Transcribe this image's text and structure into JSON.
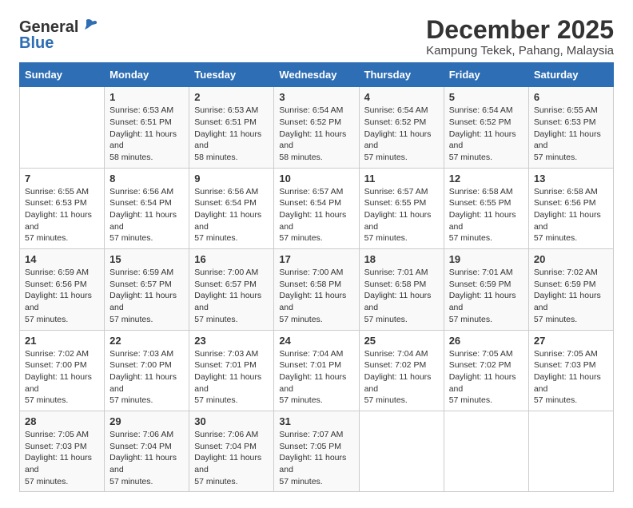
{
  "logo": {
    "general": "General",
    "blue": "Blue"
  },
  "title": "December 2025",
  "subtitle": "Kampung Tekek, Pahang, Malaysia",
  "header": {
    "days": [
      "Sunday",
      "Monday",
      "Tuesday",
      "Wednesday",
      "Thursday",
      "Friday",
      "Saturday"
    ]
  },
  "weeks": [
    [
      {
        "num": "",
        "sunrise": "",
        "sunset": "",
        "daylight": ""
      },
      {
        "num": "1",
        "sunrise": "Sunrise: 6:53 AM",
        "sunset": "Sunset: 6:51 PM",
        "daylight": "Daylight: 11 hours and 58 minutes."
      },
      {
        "num": "2",
        "sunrise": "Sunrise: 6:53 AM",
        "sunset": "Sunset: 6:51 PM",
        "daylight": "Daylight: 11 hours and 58 minutes."
      },
      {
        "num": "3",
        "sunrise": "Sunrise: 6:54 AM",
        "sunset": "Sunset: 6:52 PM",
        "daylight": "Daylight: 11 hours and 58 minutes."
      },
      {
        "num": "4",
        "sunrise": "Sunrise: 6:54 AM",
        "sunset": "Sunset: 6:52 PM",
        "daylight": "Daylight: 11 hours and 57 minutes."
      },
      {
        "num": "5",
        "sunrise": "Sunrise: 6:54 AM",
        "sunset": "Sunset: 6:52 PM",
        "daylight": "Daylight: 11 hours and 57 minutes."
      },
      {
        "num": "6",
        "sunrise": "Sunrise: 6:55 AM",
        "sunset": "Sunset: 6:53 PM",
        "daylight": "Daylight: 11 hours and 57 minutes."
      }
    ],
    [
      {
        "num": "7",
        "sunrise": "Sunrise: 6:55 AM",
        "sunset": "Sunset: 6:53 PM",
        "daylight": "Daylight: 11 hours and 57 minutes."
      },
      {
        "num": "8",
        "sunrise": "Sunrise: 6:56 AM",
        "sunset": "Sunset: 6:54 PM",
        "daylight": "Daylight: 11 hours and 57 minutes."
      },
      {
        "num": "9",
        "sunrise": "Sunrise: 6:56 AM",
        "sunset": "Sunset: 6:54 PM",
        "daylight": "Daylight: 11 hours and 57 minutes."
      },
      {
        "num": "10",
        "sunrise": "Sunrise: 6:57 AM",
        "sunset": "Sunset: 6:54 PM",
        "daylight": "Daylight: 11 hours and 57 minutes."
      },
      {
        "num": "11",
        "sunrise": "Sunrise: 6:57 AM",
        "sunset": "Sunset: 6:55 PM",
        "daylight": "Daylight: 11 hours and 57 minutes."
      },
      {
        "num": "12",
        "sunrise": "Sunrise: 6:58 AM",
        "sunset": "Sunset: 6:55 PM",
        "daylight": "Daylight: 11 hours and 57 minutes."
      },
      {
        "num": "13",
        "sunrise": "Sunrise: 6:58 AM",
        "sunset": "Sunset: 6:56 PM",
        "daylight": "Daylight: 11 hours and 57 minutes."
      }
    ],
    [
      {
        "num": "14",
        "sunrise": "Sunrise: 6:59 AM",
        "sunset": "Sunset: 6:56 PM",
        "daylight": "Daylight: 11 hours and 57 minutes."
      },
      {
        "num": "15",
        "sunrise": "Sunrise: 6:59 AM",
        "sunset": "Sunset: 6:57 PM",
        "daylight": "Daylight: 11 hours and 57 minutes."
      },
      {
        "num": "16",
        "sunrise": "Sunrise: 7:00 AM",
        "sunset": "Sunset: 6:57 PM",
        "daylight": "Daylight: 11 hours and 57 minutes."
      },
      {
        "num": "17",
        "sunrise": "Sunrise: 7:00 AM",
        "sunset": "Sunset: 6:58 PM",
        "daylight": "Daylight: 11 hours and 57 minutes."
      },
      {
        "num": "18",
        "sunrise": "Sunrise: 7:01 AM",
        "sunset": "Sunset: 6:58 PM",
        "daylight": "Daylight: 11 hours and 57 minutes."
      },
      {
        "num": "19",
        "sunrise": "Sunrise: 7:01 AM",
        "sunset": "Sunset: 6:59 PM",
        "daylight": "Daylight: 11 hours and 57 minutes."
      },
      {
        "num": "20",
        "sunrise": "Sunrise: 7:02 AM",
        "sunset": "Sunset: 6:59 PM",
        "daylight": "Daylight: 11 hours and 57 minutes."
      }
    ],
    [
      {
        "num": "21",
        "sunrise": "Sunrise: 7:02 AM",
        "sunset": "Sunset: 7:00 PM",
        "daylight": "Daylight: 11 hours and 57 minutes."
      },
      {
        "num": "22",
        "sunrise": "Sunrise: 7:03 AM",
        "sunset": "Sunset: 7:00 PM",
        "daylight": "Daylight: 11 hours and 57 minutes."
      },
      {
        "num": "23",
        "sunrise": "Sunrise: 7:03 AM",
        "sunset": "Sunset: 7:01 PM",
        "daylight": "Daylight: 11 hours and 57 minutes."
      },
      {
        "num": "24",
        "sunrise": "Sunrise: 7:04 AM",
        "sunset": "Sunset: 7:01 PM",
        "daylight": "Daylight: 11 hours and 57 minutes."
      },
      {
        "num": "25",
        "sunrise": "Sunrise: 7:04 AM",
        "sunset": "Sunset: 7:02 PM",
        "daylight": "Daylight: 11 hours and 57 minutes."
      },
      {
        "num": "26",
        "sunrise": "Sunrise: 7:05 AM",
        "sunset": "Sunset: 7:02 PM",
        "daylight": "Daylight: 11 hours and 57 minutes."
      },
      {
        "num": "27",
        "sunrise": "Sunrise: 7:05 AM",
        "sunset": "Sunset: 7:03 PM",
        "daylight": "Daylight: 11 hours and 57 minutes."
      }
    ],
    [
      {
        "num": "28",
        "sunrise": "Sunrise: 7:05 AM",
        "sunset": "Sunset: 7:03 PM",
        "daylight": "Daylight: 11 hours and 57 minutes."
      },
      {
        "num": "29",
        "sunrise": "Sunrise: 7:06 AM",
        "sunset": "Sunset: 7:04 PM",
        "daylight": "Daylight: 11 hours and 57 minutes."
      },
      {
        "num": "30",
        "sunrise": "Sunrise: 7:06 AM",
        "sunset": "Sunset: 7:04 PM",
        "daylight": "Daylight: 11 hours and 57 minutes."
      },
      {
        "num": "31",
        "sunrise": "Sunrise: 7:07 AM",
        "sunset": "Sunset: 7:05 PM",
        "daylight": "Daylight: 11 hours and 57 minutes."
      },
      {
        "num": "",
        "sunrise": "",
        "sunset": "",
        "daylight": ""
      },
      {
        "num": "",
        "sunrise": "",
        "sunset": "",
        "daylight": ""
      },
      {
        "num": "",
        "sunrise": "",
        "sunset": "",
        "daylight": ""
      }
    ]
  ]
}
